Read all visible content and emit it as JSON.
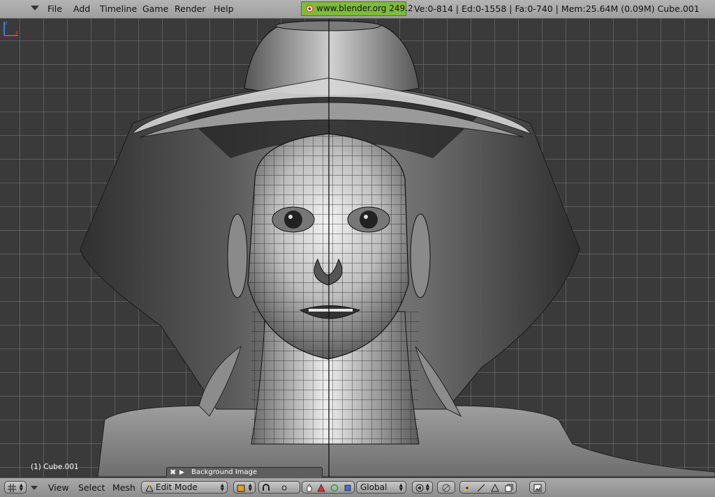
{
  "menubar": {
    "items": [
      "File",
      "Add",
      "Timeline",
      "Game",
      "Render",
      "Help"
    ],
    "version_badge": "www.blender.org 249.2",
    "stats": "Ve:0-814 | Ed:0-1558 | Fa:0-740 | Mem:25.64M (0.09M) Cube.001"
  },
  "viewport": {
    "object_label": "(1) Cube.001",
    "background_panel_label": "Background Image"
  },
  "bottombar": {
    "menus": [
      "View",
      "Select",
      "Mesh"
    ],
    "mode": "Edit Mode",
    "orientation": "Global"
  },
  "colors": {
    "menubar_bg": "#a8a8a8",
    "version_badge_bg": "#7fba3c",
    "viewport_bg": "#3a3a3a",
    "grid_line": "#787878"
  },
  "icons": [
    "menu-collapse-icon",
    "blender-logo-icon",
    "axis-gizmo-icon",
    "close-icon",
    "play-icon",
    "editor-type-icon",
    "edit-mode-icon",
    "draw-type-icon",
    "shading-icon",
    "pivot-icon",
    "hand-cursor-icon",
    "manipulator-translate-icon",
    "manipulator-rotate-icon",
    "manipulator-scale-icon",
    "proportional-edit-icon",
    "snap-icon",
    "vertex-select-icon",
    "edge-select-icon",
    "face-select-icon",
    "occlude-icon",
    "render-icon"
  ]
}
